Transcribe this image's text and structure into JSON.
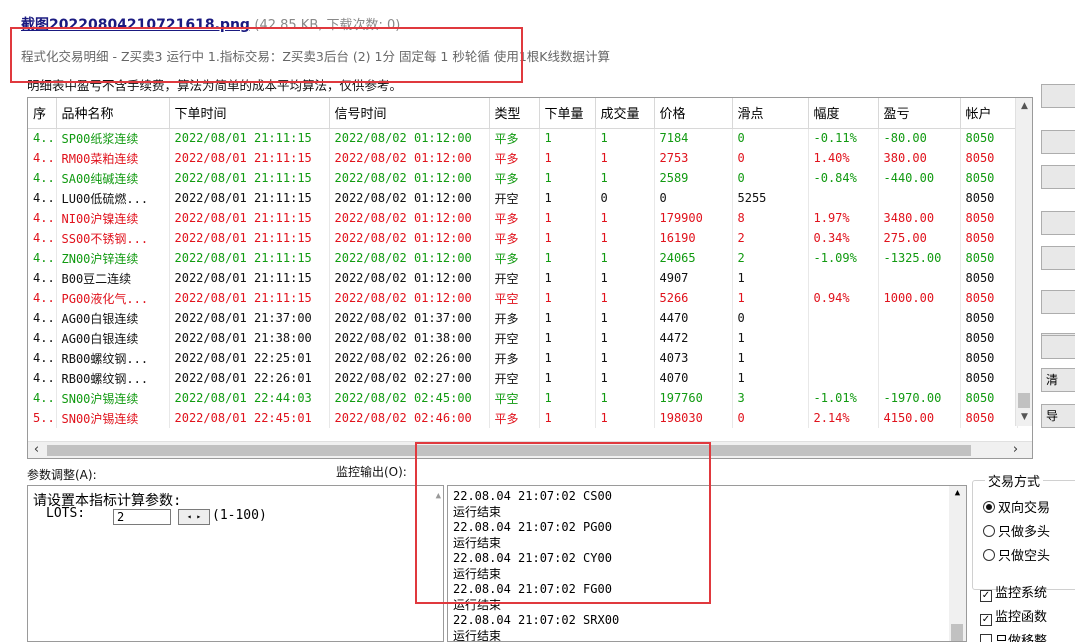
{
  "header": {
    "file_name": "截图20220804210721618.png",
    "file_meta": "(42.85 KB, 下载次数: 0)",
    "subtitle": "程式化交易明细 - Z买卖3 运行中  1.指标交易：Z买卖3后台 (2) 1分 固定每 1 秒轮循 使用1根K线数据计算",
    "note": "明细表中盈亏不含手续费，算法为简单的成本平均算法，仅供参考。"
  },
  "table": {
    "columns": [
      "序",
      "品种名称",
      "下单时间",
      "信号时间",
      "类型",
      "下单量",
      "成交量",
      "价格",
      "滑点",
      "幅度",
      "盈亏",
      "帐户"
    ],
    "rows": [
      {
        "color": "green",
        "cells": [
          "4..",
          "SP00纸浆连续",
          "2022/08/01 21:11:15",
          "2022/08/02 01:12:00",
          "平多",
          "1",
          "1",
          "7184",
          "0",
          "-0.11%",
          "-80.00",
          "8050"
        ]
      },
      {
        "color": "red",
        "cells": [
          "4..",
          "RM00菜粕连续",
          "2022/08/01 21:11:15",
          "2022/08/02 01:12:00",
          "平多",
          "1",
          "1",
          "2753",
          "0",
          "1.40%",
          "380.00",
          "8050"
        ]
      },
      {
        "color": "green",
        "cells": [
          "4..",
          "SA00纯碱连续",
          "2022/08/01 21:11:15",
          "2022/08/02 01:12:00",
          "平多",
          "1",
          "1",
          "2589",
          "0",
          "-0.84%",
          "-440.00",
          "8050"
        ]
      },
      {
        "color": "black",
        "cells": [
          "4..",
          "LU00低硫燃...",
          "2022/08/01 21:11:15",
          "2022/08/02 01:12:00",
          "开空",
          "1",
          "0",
          "0",
          "5255",
          "",
          "",
          "8050"
        ]
      },
      {
        "color": "red",
        "cells": [
          "4..",
          "NI00沪镍连续",
          "2022/08/01 21:11:15",
          "2022/08/02 01:12:00",
          "平多",
          "1",
          "1",
          "179900",
          "8",
          "1.97%",
          "3480.00",
          "8050"
        ]
      },
      {
        "color": "red",
        "cells": [
          "4..",
          "SS00不锈钢...",
          "2022/08/01 21:11:15",
          "2022/08/02 01:12:00",
          "平多",
          "1",
          "1",
          "16190",
          "2",
          "0.34%",
          "275.00",
          "8050"
        ]
      },
      {
        "color": "green",
        "cells": [
          "4..",
          "ZN00沪锌连续",
          "2022/08/01 21:11:15",
          "2022/08/02 01:12:00",
          "平多",
          "1",
          "1",
          "24065",
          "2",
          "-1.09%",
          "-1325.00",
          "8050"
        ]
      },
      {
        "color": "black",
        "cells": [
          "4..",
          "B00豆二连续",
          "2022/08/01 21:11:15",
          "2022/08/02 01:12:00",
          "开空",
          "1",
          "1",
          "4907",
          "1",
          "",
          "",
          "8050"
        ]
      },
      {
        "color": "red",
        "cells": [
          "4..",
          "PG00液化气...",
          "2022/08/01 21:11:15",
          "2022/08/02 01:12:00",
          "平空",
          "1",
          "1",
          "5266",
          "1",
          "0.94%",
          "1000.00",
          "8050"
        ]
      },
      {
        "color": "black",
        "cells": [
          "4..",
          "AG00白银连续",
          "2022/08/01 21:37:00",
          "2022/08/02 01:37:00",
          "开多",
          "1",
          "1",
          "4470",
          "0",
          "",
          "",
          "8050"
        ]
      },
      {
        "color": "black",
        "cells": [
          "4..",
          "AG00白银连续",
          "2022/08/01 21:38:00",
          "2022/08/02 01:38:00",
          "开空",
          "1",
          "1",
          "4472",
          "1",
          "",
          "",
          "8050"
        ]
      },
      {
        "color": "black",
        "cells": [
          "4..",
          "RB00螺纹钢...",
          "2022/08/01 22:25:01",
          "2022/08/02 02:26:00",
          "开多",
          "1",
          "1",
          "4073",
          "1",
          "",
          "",
          "8050"
        ]
      },
      {
        "color": "black",
        "cells": [
          "4..",
          "RB00螺纹钢...",
          "2022/08/01 22:26:01",
          "2022/08/02 02:27:00",
          "开空",
          "1",
          "1",
          "4070",
          "1",
          "",
          "",
          "8050"
        ]
      },
      {
        "color": "green",
        "cells": [
          "4..",
          "SN00沪锡连续",
          "2022/08/01 22:44:03",
          "2022/08/02 02:45:00",
          "平空",
          "1",
          "1",
          "197760",
          "3",
          "-1.01%",
          "-1970.00",
          "8050"
        ]
      },
      {
        "color": "red",
        "cells": [
          "5..",
          "SN00沪锡连续",
          "2022/08/01 22:45:01",
          "2022/08/02 02:46:00",
          "平多",
          "1",
          "1",
          "198030",
          "0",
          "2.14%",
          "4150.00",
          "8050"
        ]
      }
    ]
  },
  "side_buttons": [
    "",
    "",
    "",
    "",
    "",
    "",
    "",
    "",
    "",
    "清",
    "导"
  ],
  "params": {
    "label": "参数调整(A):",
    "prompt": "请设置本指标计算参数:",
    "lots_label": "LOTS:",
    "lots_value": "2",
    "lots_range": "(1-100)"
  },
  "monitor": {
    "label": "监控输出(O):",
    "entries": [
      {
        "time": "22.08.04 21:07:02 CS00",
        "msg": "运行结束"
      },
      {
        "time": "22.08.04 21:07:02 PG00",
        "msg": "运行结束"
      },
      {
        "time": "22.08.04 21:07:02 CY00",
        "msg": "运行结束"
      },
      {
        "time": "22.08.04 21:07:02 FG00",
        "msg": "运行结束"
      },
      {
        "time": "22.08.04 21:07:02 SRX00",
        "msg": "运行结束"
      }
    ]
  },
  "trade_mode": {
    "label": "交易方式",
    "options": [
      "双向交易",
      "只做多头",
      "只做空头"
    ],
    "selected": "双向交易"
  },
  "checks": [
    {
      "label": "监控系统",
      "checked": true
    },
    {
      "label": "监控函数",
      "checked": true
    },
    {
      "label": "只做移整",
      "checked": false
    }
  ]
}
